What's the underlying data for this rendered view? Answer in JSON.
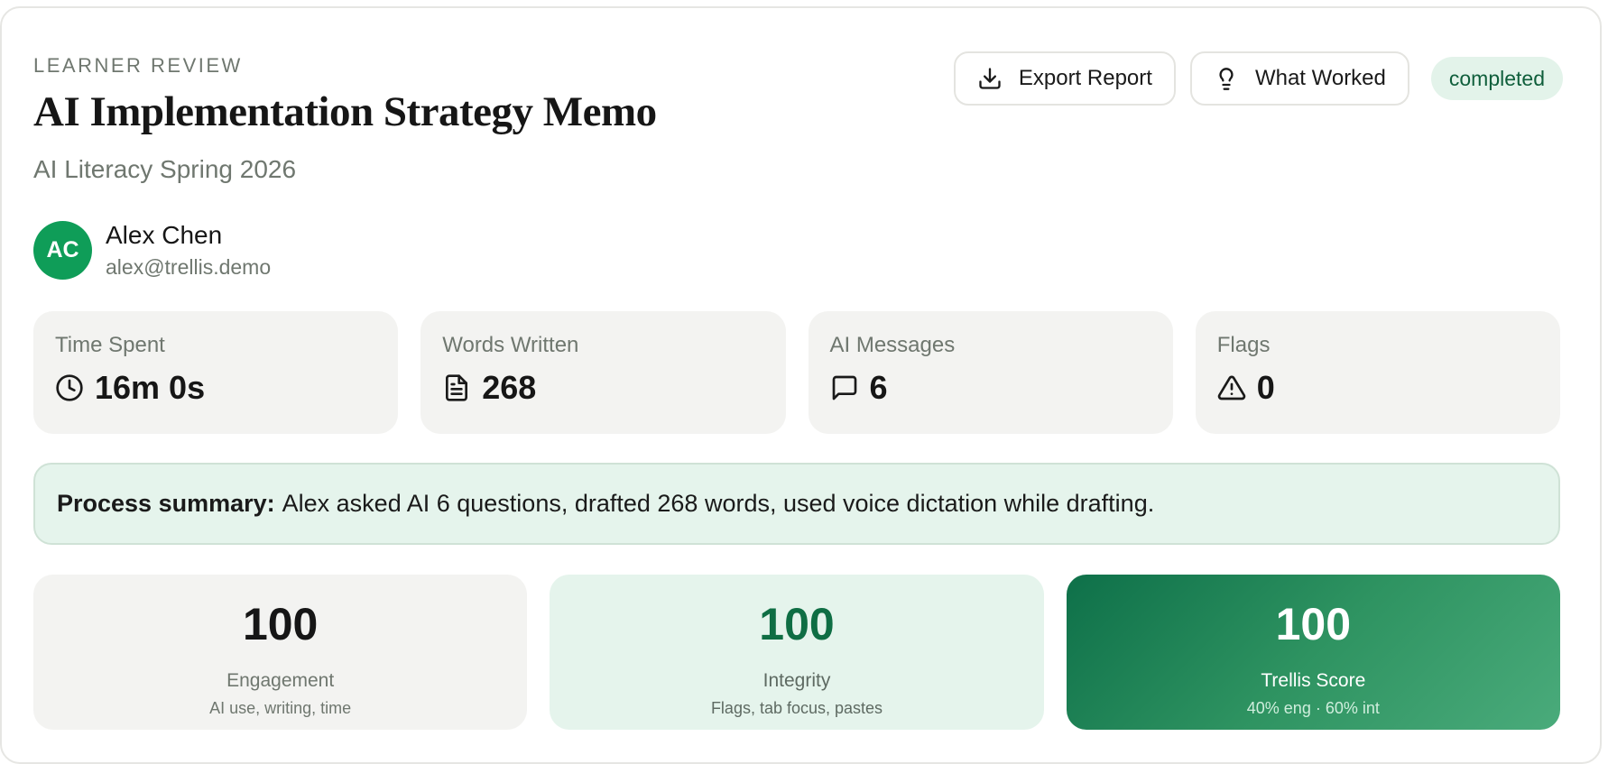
{
  "header": {
    "eyebrow": "LEARNER REVIEW",
    "title": "AI Implementation Strategy Memo",
    "subtitle": "AI Literacy Spring 2026"
  },
  "actions": {
    "export_label": "Export Report",
    "what_worked_label": "What Worked",
    "status": "completed"
  },
  "learner": {
    "initials": "AC",
    "name": "Alex Chen",
    "email": "alex@trellis.demo"
  },
  "stats": [
    {
      "label": "Time Spent",
      "value": "16m 0s",
      "icon": "clock-icon"
    },
    {
      "label": "Words Written",
      "value": "268",
      "icon": "document-icon"
    },
    {
      "label": "AI Messages",
      "value": "6",
      "icon": "chat-icon"
    },
    {
      "label": "Flags",
      "value": "0",
      "icon": "warning-icon"
    }
  ],
  "summary": {
    "label": "Process summary:",
    "text": "Alex asked AI 6 questions, drafted 268 words, used voice dictation while drafting."
  },
  "scores": [
    {
      "value": "100",
      "label": "Engagement",
      "sub": "AI use, writing, time"
    },
    {
      "value": "100",
      "label": "Integrity",
      "sub": "Flags, tab focus, pastes"
    },
    {
      "value": "100",
      "label": "Trellis Score",
      "sub": "40% eng · 60% int"
    }
  ],
  "colors": {
    "accent": "#0f9d58",
    "accent_dark": "#0f6e44",
    "badge_bg": "#e3f3ea",
    "summary_bg": "#e5f4ec"
  }
}
